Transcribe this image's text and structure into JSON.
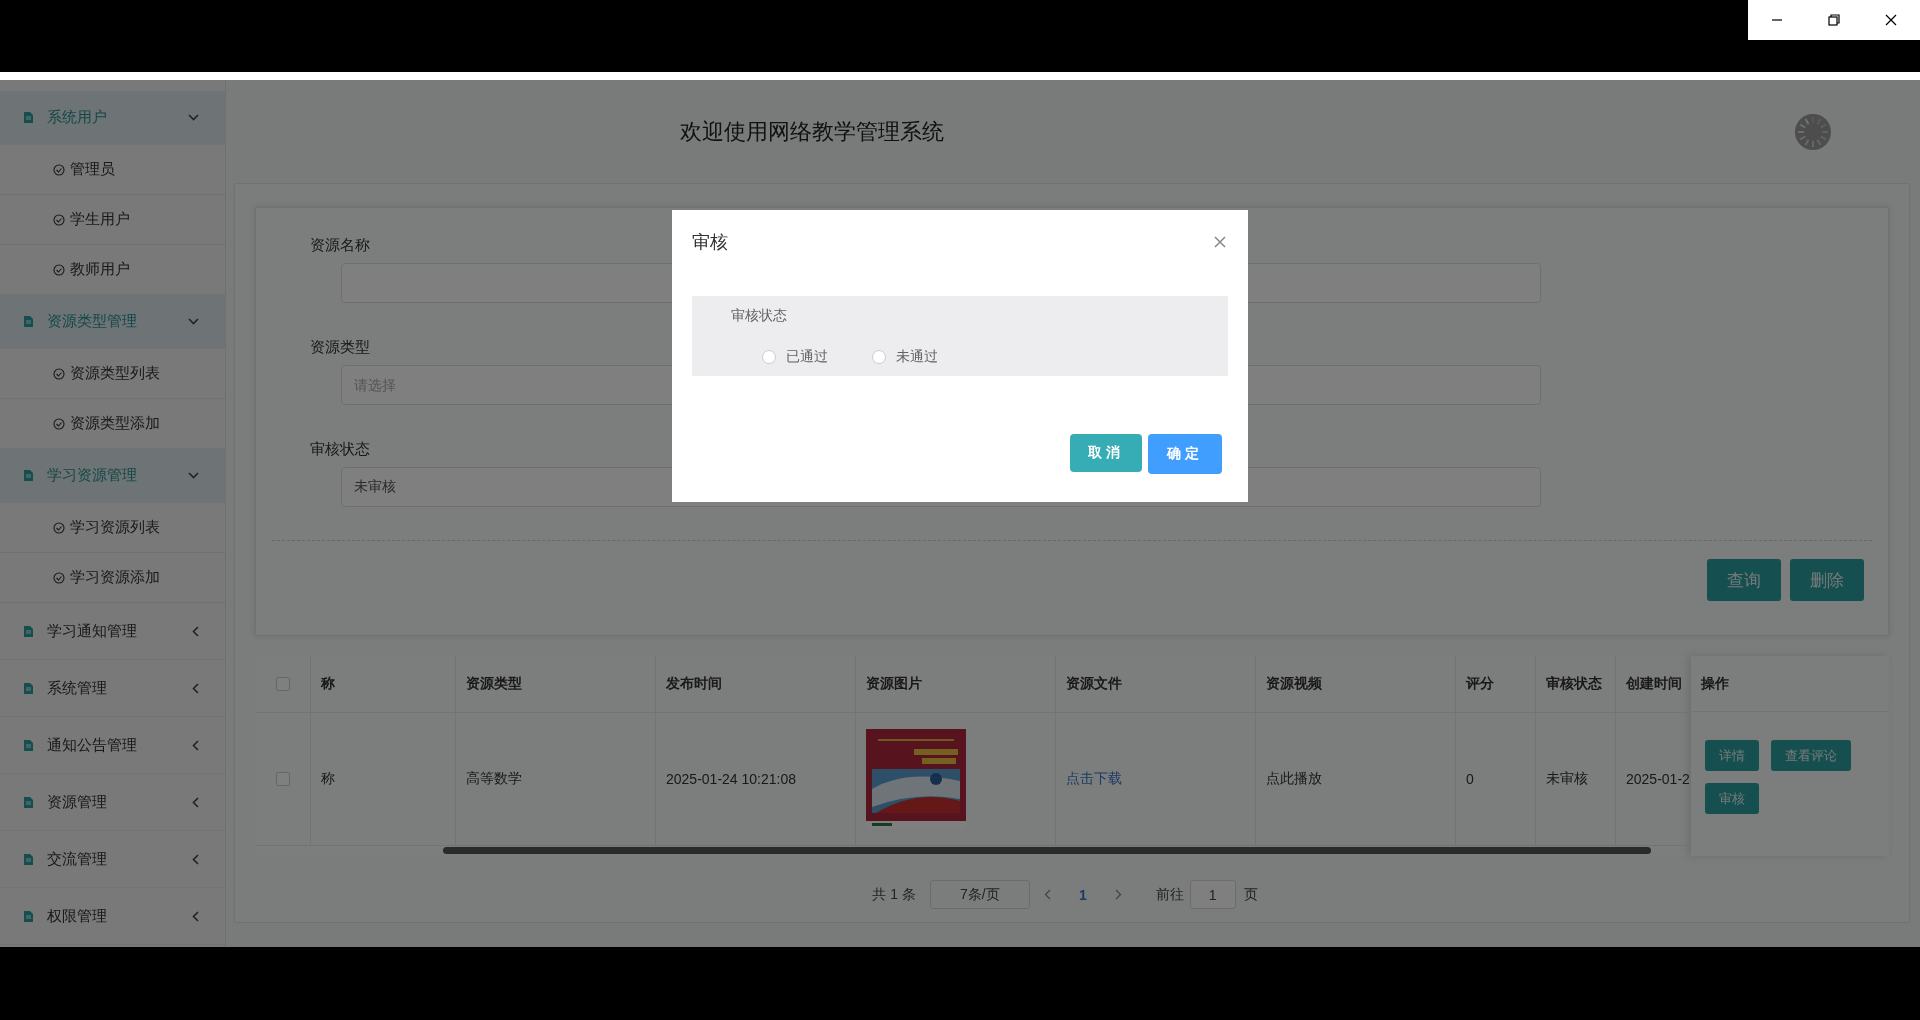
{
  "header": {
    "title": "欢迎使用网络教学管理系统"
  },
  "sidebar": {
    "menus": [
      {
        "label": "系统用户",
        "expanded": true,
        "children": [
          {
            "label": "管理员"
          },
          {
            "label": "学生用户"
          },
          {
            "label": "教师用户"
          }
        ]
      },
      {
        "label": "资源类型管理",
        "expanded": true,
        "children": [
          {
            "label": "资源类型列表"
          },
          {
            "label": "资源类型添加"
          }
        ]
      },
      {
        "label": "学习资源管理",
        "expanded": true,
        "children": [
          {
            "label": "学习资源列表"
          },
          {
            "label": "学习资源添加"
          }
        ]
      },
      {
        "label": "学习通知管理",
        "expanded": false
      },
      {
        "label": "系统管理",
        "expanded": false
      },
      {
        "label": "通知公告管理",
        "expanded": false
      },
      {
        "label": "资源管理",
        "expanded": false
      },
      {
        "label": "交流管理",
        "expanded": false
      },
      {
        "label": "权限管理",
        "expanded": false
      }
    ]
  },
  "search_form": {
    "fields": [
      {
        "label": "资源名称"
      },
      {
        "label": "资源类型",
        "placeholder": "请选择"
      },
      {
        "label": "审核状态",
        "value": "未审核"
      }
    ],
    "buttons": [
      "查询",
      "删除"
    ]
  },
  "table": {
    "header_checked": false,
    "columns": [
      "称",
      "资源类型",
      "发布时间",
      "资源图片",
      "资源文件",
      "资源视频",
      "评分",
      "审核状态",
      "创建时间",
      "操作"
    ],
    "rows": [
      {
        "checked": false,
        "cells": [
          {
            "kind": "text",
            "text": "称"
          },
          {
            "kind": "text",
            "text": "高等数学"
          },
          {
            "kind": "text",
            "text": "2025-01-24 10:21:08"
          },
          {
            "kind": "picture"
          },
          {
            "kind": "link",
            "text": "点击下载"
          },
          {
            "kind": "text",
            "text": "点此播放"
          },
          {
            "kind": "text",
            "text": "0"
          },
          {
            "kind": "text",
            "text": "未审核"
          },
          {
            "kind": "text",
            "text": "2025-01-2"
          }
        ],
        "actions": [
          "详情",
          "查看评论",
          "审核"
        ]
      }
    ]
  },
  "pagination": {
    "total": "共 1 条",
    "page_size": "7条/页",
    "pages": [
      {
        "label": "1",
        "selected": true
      }
    ],
    "goto_label": "前往",
    "goto_value": "1",
    "goto_suffix": "页"
  },
  "dialog": {
    "title": "审核",
    "group_label": "审核状态",
    "options": [
      {
        "label": "已通过",
        "selected": false
      },
      {
        "label": "未通过",
        "selected": false
      }
    ],
    "cancel": "取消",
    "confirm": "确定"
  }
}
